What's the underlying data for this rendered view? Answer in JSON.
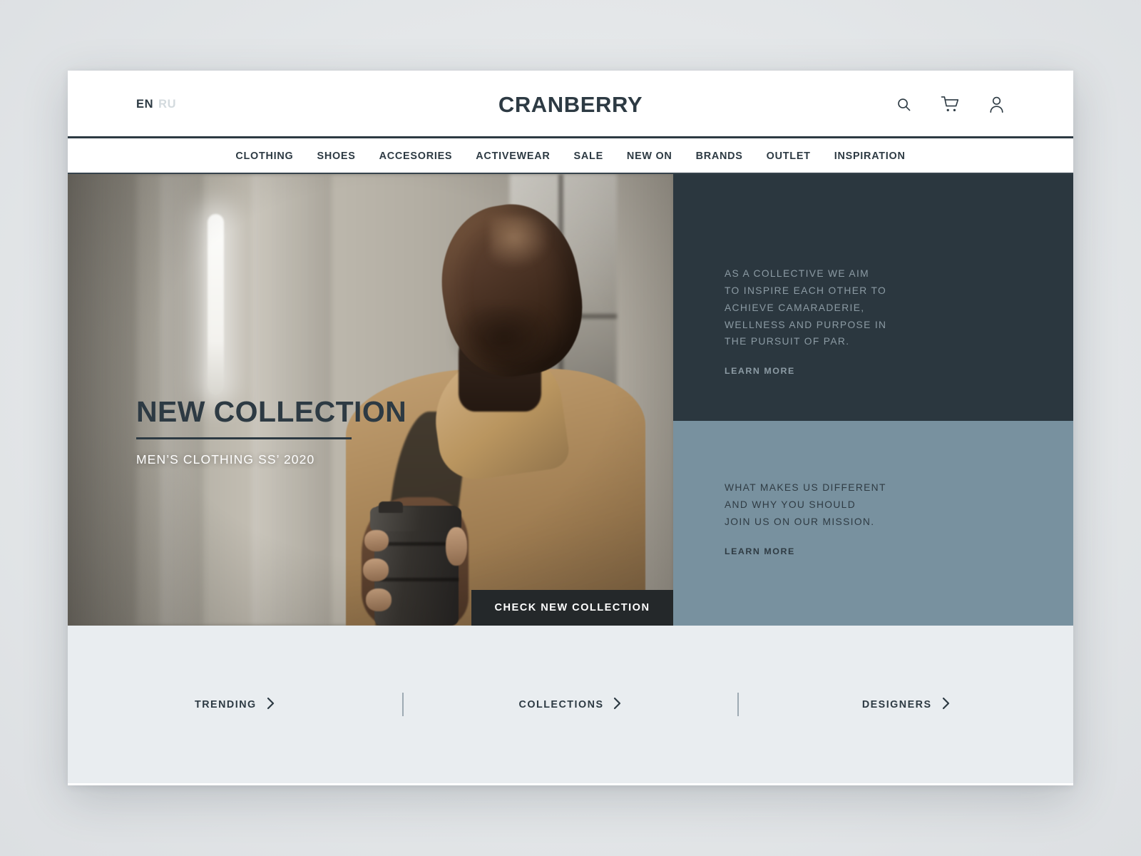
{
  "header": {
    "lang_active": "EN",
    "lang_inactive": "RU",
    "brand": "CRANBERRY",
    "icons": [
      "search-icon",
      "cart-icon",
      "user-icon"
    ]
  },
  "nav": {
    "items": [
      {
        "label": "CLOTHING"
      },
      {
        "label": "SHOES"
      },
      {
        "label": "ACCESORIES"
      },
      {
        "label": "ACTIVEWEAR"
      },
      {
        "label": "SALE"
      },
      {
        "label": "NEW ON"
      },
      {
        "label": "BRANDS"
      },
      {
        "label": "OUTLET"
      },
      {
        "label": "INSPIRATION"
      }
    ]
  },
  "hero": {
    "title": "NEW COLLECTION",
    "subtitle": "MEN’S CLOTHING\nSS’ 2020",
    "cta_label": "CHECK NEW COLLECTION"
  },
  "panels": {
    "dark": {
      "text": "AS A COLLECTIVE WE AIM\nTO INSPIRE EACH OTHER TO\nACHIEVE CAMARADERIE,\nWELLNESS AND PURPOSE IN\nTHE PURSUIT OF PAR.",
      "link": "LEARN MORE",
      "color": "#2b373f"
    },
    "blue": {
      "text": "WHAT MAKES US DIFFERENT\nAND WHY YOU SHOULD\nJOIN US ON OUR MISSION.",
      "link": "LEARN MORE",
      "color": "#78919f"
    }
  },
  "bottom": {
    "links": [
      {
        "label": "TRENDING"
      },
      {
        "label": "COLLECTIONS"
      },
      {
        "label": "DESIGNERS"
      }
    ]
  },
  "colors": {
    "ink": "#2d3a43",
    "cta_bg": "#24282a",
    "bottom_bg": "#e9edf0",
    "page_bg": "#ffffff"
  }
}
